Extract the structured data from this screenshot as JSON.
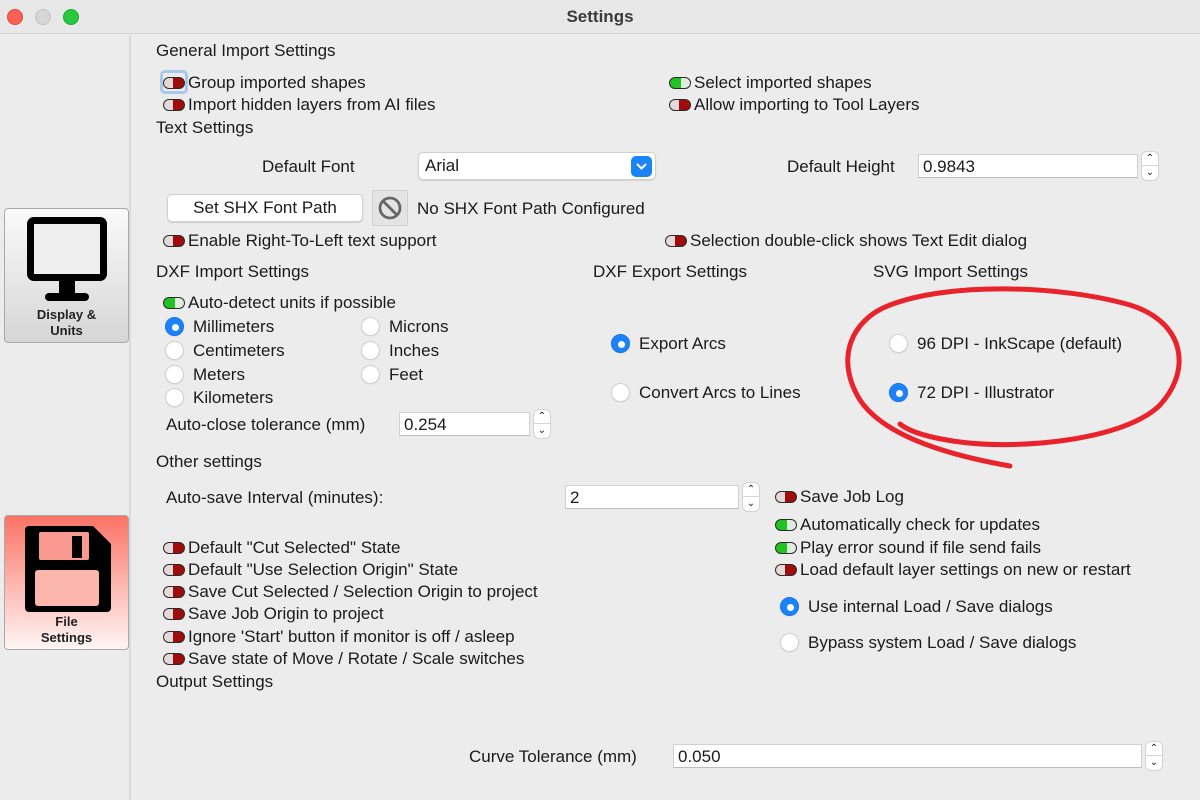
{
  "window": {
    "title": "Settings"
  },
  "sidebar": {
    "items": [
      {
        "label": "Display &\nUnits",
        "line1": "Display &",
        "line2": "Units",
        "icon": "monitor-icon",
        "selected": false
      },
      {
        "label": "File\nSettings",
        "line1": "File",
        "line2": "Settings",
        "icon": "floppy-disk-icon",
        "selected": true
      }
    ]
  },
  "general_import": {
    "heading": "General Import Settings",
    "toggles": [
      {
        "label": "Group imported shapes",
        "on": false
      },
      {
        "label": "Select imported shapes",
        "on": true
      },
      {
        "label": "Import hidden layers from AI files",
        "on": false
      },
      {
        "label": "Allow importing to Tool Layers",
        "on": false
      }
    ]
  },
  "text_settings": {
    "heading": "Text Settings",
    "default_font_label": "Default Font",
    "default_font_value": "Arial",
    "default_height_label": "Default Height",
    "default_height_value": "0.9843",
    "shx_button": "Set SHX Font Path",
    "shx_status_icon": "prohibited-icon",
    "shx_status": "No SHX Font Path Configured",
    "toggles": [
      {
        "label": "Enable Right-To-Left text support",
        "on": false
      },
      {
        "label": "Selection double-click shows Text Edit dialog",
        "on": false
      }
    ]
  },
  "dxf_import": {
    "heading": "DXF Import Settings",
    "auto_detect": {
      "label": "Auto-detect units if possible",
      "on": true
    },
    "units": [
      {
        "label": "Millimeters",
        "selected": true
      },
      {
        "label": "Microns",
        "selected": false
      },
      {
        "label": "Centimeters",
        "selected": false
      },
      {
        "label": "Inches",
        "selected": false
      },
      {
        "label": "Meters",
        "selected": false
      },
      {
        "label": "Feet",
        "selected": false
      },
      {
        "label": "Kilometers",
        "selected": false
      }
    ],
    "tolerance_label": "Auto-close tolerance (mm)",
    "tolerance_value": "0.254"
  },
  "dxf_export": {
    "heading": "DXF Export Settings",
    "options": [
      {
        "label": "Export Arcs",
        "selected": true
      },
      {
        "label": "Convert Arcs to Lines",
        "selected": false
      }
    ]
  },
  "svg_import": {
    "heading": "SVG Import Settings",
    "options": [
      {
        "label": "96 DPI - InkScape (default)",
        "selected": false
      },
      {
        "label": "72 DPI - Illustrator",
        "selected": true
      }
    ],
    "annotation_color": "#e8232b"
  },
  "other": {
    "heading": "Other settings",
    "autosave_label": "Auto-save Interval (minutes):",
    "autosave_value": "2",
    "left_toggles": [
      {
        "label": "Default \"Cut Selected\" State",
        "on": false
      },
      {
        "label": "Default \"Use Selection Origin\" State",
        "on": false
      },
      {
        "label": "Save Cut Selected / Selection Origin to project",
        "on": false
      },
      {
        "label": "Save Job Origin to project",
        "on": false
      },
      {
        "label": "Ignore 'Start' button if monitor is off / asleep",
        "on": false
      },
      {
        "label": "Save state of Move / Rotate / Scale switches",
        "on": false
      }
    ],
    "right_toggles": [
      {
        "label": "Save Job Log",
        "on": false
      },
      {
        "label": "Automatically check for updates",
        "on": true
      },
      {
        "label": "Play error sound if file send fails",
        "on": true
      },
      {
        "label": "Load default layer settings on new or restart",
        "on": false
      }
    ],
    "dialog_options": [
      {
        "label": "Use internal Load / Save dialogs",
        "selected": true
      },
      {
        "label": "Bypass system Load / Save dialogs",
        "selected": false
      }
    ]
  },
  "output": {
    "heading": "Output Settings",
    "curve_tolerance_label": "Curve Tolerance (mm)",
    "curve_tolerance_value": "0.050"
  },
  "colors": {
    "accent": "#1a82fb",
    "toggle_on": "#21c321",
    "toggle_off": "#a00b0b",
    "active_sidebar": "#fb7366"
  }
}
